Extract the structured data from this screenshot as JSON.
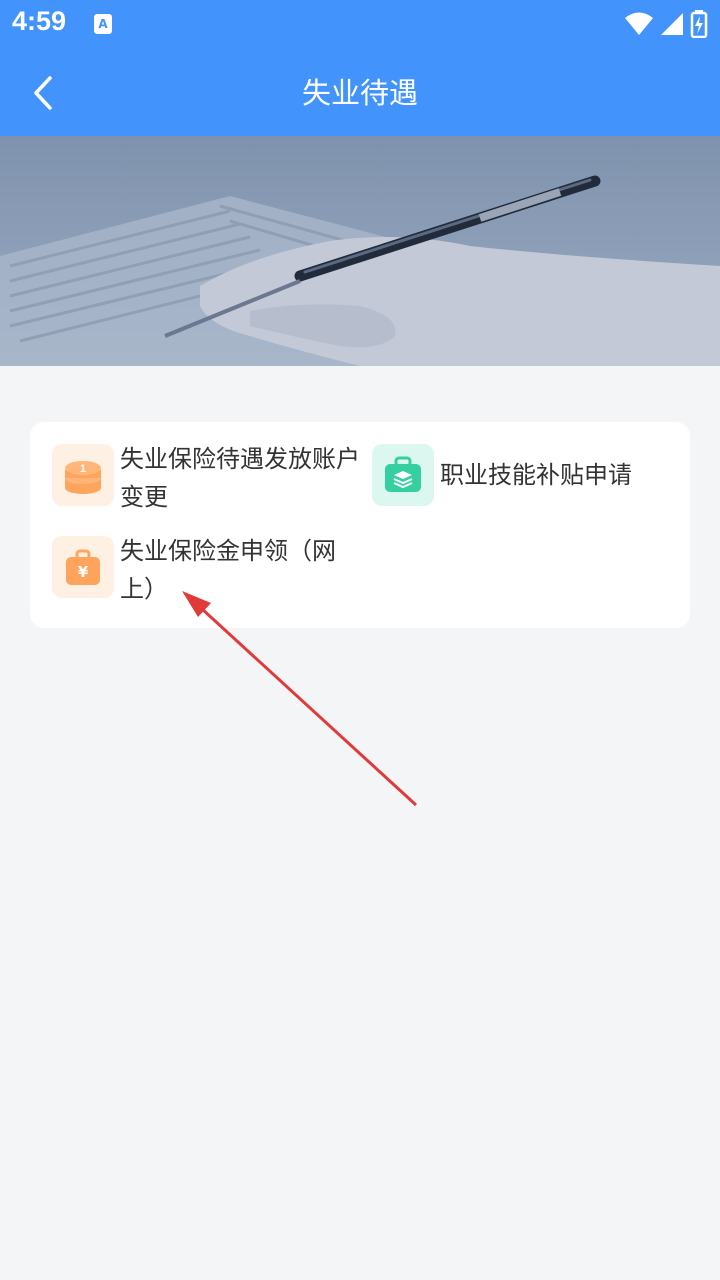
{
  "status_bar": {
    "time": "4:59",
    "notification_icon_letter": "A"
  },
  "header": {
    "title": "失业待遇",
    "back_icon": "chevron-left-icon",
    "background": "#4294fc"
  },
  "banner": {
    "image": "hand-holding-pen-over-document"
  },
  "menu": {
    "items": [
      {
        "label": "失业保险待遇发放账户变更",
        "icon": "coin-stack-icon",
        "icon_color": "#ffa45c"
      },
      {
        "label": "职业技能补贴申请",
        "icon": "briefcase-layers-icon",
        "icon_color": "#35cfa1"
      },
      {
        "label": "失业保险金申领（网上）",
        "icon": "yuan-bag-icon",
        "icon_color": "#ffa45c"
      }
    ]
  },
  "annotation": {
    "type": "red-arrow",
    "color": "#e03a3a"
  }
}
